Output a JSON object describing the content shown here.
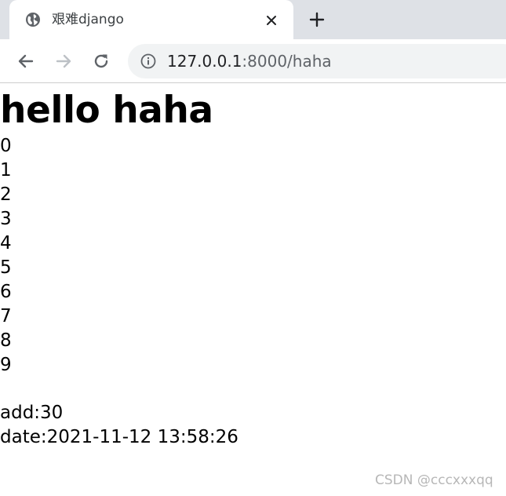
{
  "browser": {
    "tab": {
      "title": "艰难django",
      "favicon_icon": "globe-icon",
      "close_icon": "close-icon"
    },
    "new_tab_icon": "plus-icon",
    "toolbar": {
      "back_icon": "arrow-left-icon",
      "forward_icon": "arrow-right-icon",
      "reload_icon": "reload-icon",
      "site_info_icon": "info-icon",
      "url_host": "127.0.0.1",
      "url_rest": ":8000/haha"
    },
    "colors": {
      "tabstrip": "#dee1e6",
      "omnibox": "#f1f3f4",
      "icon": "#5f6368",
      "forward_disabled": "#bdc1c6"
    }
  },
  "page": {
    "heading": "hello haha",
    "numbers": [
      "0",
      "1",
      "2",
      "3",
      "4",
      "5",
      "6",
      "7",
      "8",
      "9"
    ],
    "add_line": "add:30",
    "date_line": "date:2021-11-12 13:58:26"
  },
  "watermark": "CSDN @cccxxxqq"
}
